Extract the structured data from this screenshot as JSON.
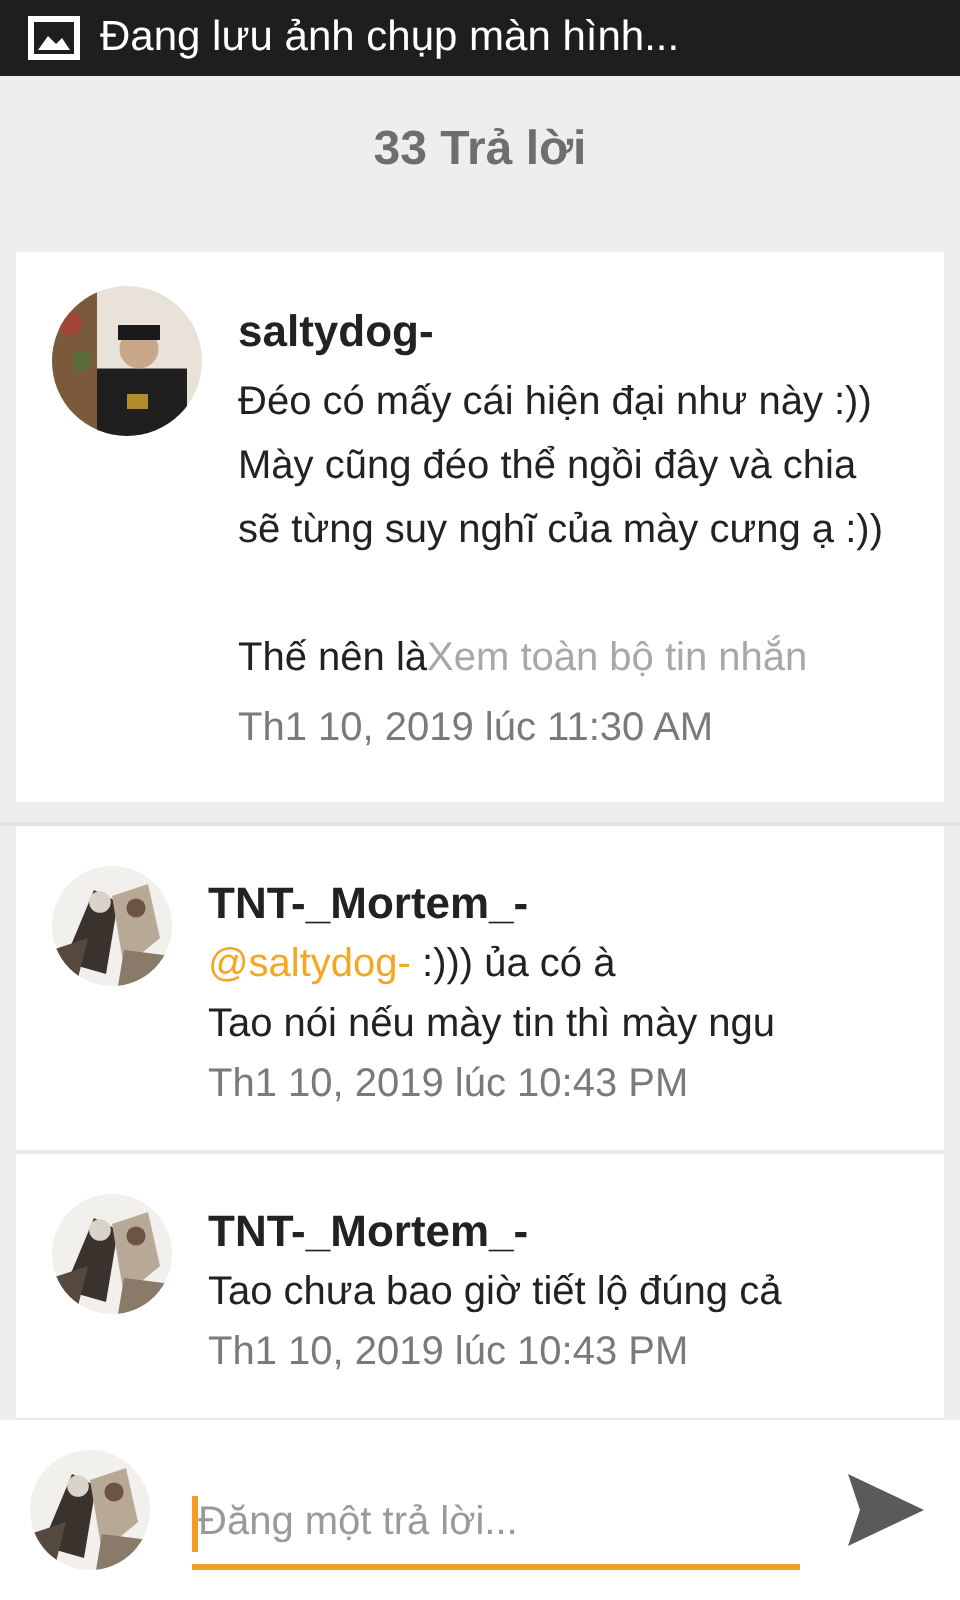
{
  "status_bar": {
    "notification": "Đang lưu ảnh chụp màn hình..."
  },
  "header": {
    "title": "33 Trả lời"
  },
  "post": {
    "author": "saltydog-",
    "paragraphs": [
      [
        "Đéo có mấy cái hiện đại như này :))",
        "Mày cũng đéo thể ngồi đây và chia",
        "sẽ từng suy nghĩ của mày cưng ạ :))"
      ],
      [
        "Thế nên là"
      ]
    ],
    "more_link": "Xem toàn bộ tin nhắn",
    "time": "Th1 10, 2019 lúc 11:30 AM"
  },
  "replies": [
    {
      "author": "TNT-_Mortem_-",
      "mention": "@saltydog-",
      "lines": [
        ":))) ủa có à",
        "Tao nói nếu mày tin thì mày ngu"
      ],
      "time": "Th1 10, 2019 lúc 10:43 PM"
    },
    {
      "author": "TNT-_Mortem_-",
      "lines": [
        "Tao chưa bao giờ tiết lộ đúng cả"
      ],
      "time": "Th1 10, 2019 lúc 10:43 PM"
    }
  ],
  "composer": {
    "placeholder": "Đăng một trả lời..."
  }
}
